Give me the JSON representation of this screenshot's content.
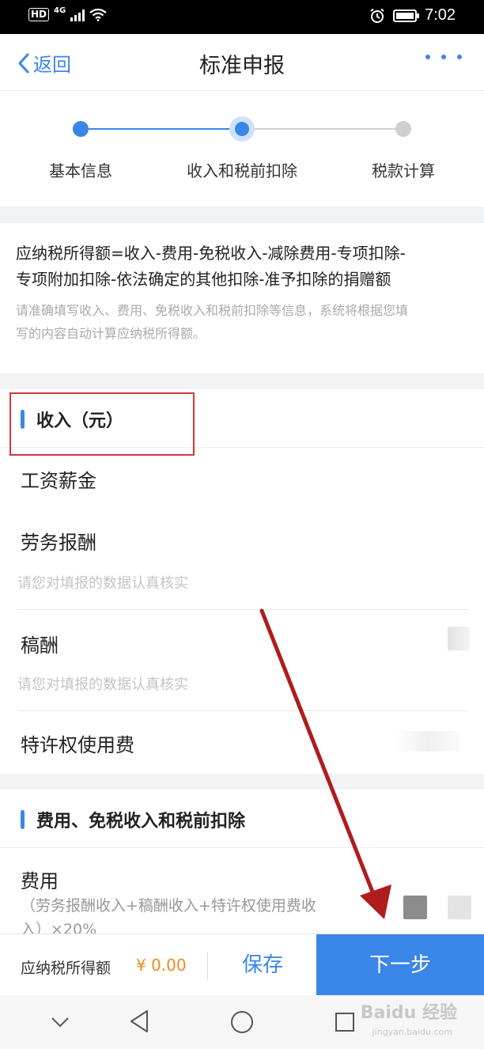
{
  "status_bar": {
    "hd": "HD",
    "network": "4G",
    "time": "7:02"
  },
  "nav": {
    "back_label": "返回",
    "title": "标准申报"
  },
  "stepper": {
    "steps": [
      {
        "label": "基本信息",
        "state": "done"
      },
      {
        "label": "收入和税前扣除",
        "state": "current"
      },
      {
        "label": "税款计算",
        "state": "pending"
      }
    ]
  },
  "formula": {
    "line1": "应纳税所得额=收入-费用-免税收入-减除费用-专项扣除-",
    "line2": "专项附加扣除-依法确定的其他扣除-准予扣除的捐赠额",
    "hint_line1": "请准确填写收入、费用、免税收入和税前扣除等信息，系统将根据您填",
    "hint_line2": "写的内容自动计算应纳税所得额。"
  },
  "income": {
    "title": "收入（元）",
    "rows": [
      {
        "label": "工资薪金"
      },
      {
        "label": "劳务报酬",
        "hint": "请您对填报的数据认真核实"
      },
      {
        "label": "稿酬",
        "hint": "请您对填报的数据认真核实"
      },
      {
        "label": "特许权使用费"
      }
    ]
  },
  "deductions": {
    "title": "费用、免税收入和税前扣除",
    "rows": [
      {
        "label": "费用",
        "note_line1": "（劳务报酬收入+稿酬收入+特许权使用费收",
        "note_line2": "入）×20%"
      }
    ]
  },
  "action_bar": {
    "tax_label": "应纳税所得额",
    "tax_value": "¥ 0.00",
    "save_label": "保存",
    "next_label": "下一步"
  },
  "watermark": {
    "text": "Baidu 经验",
    "sub": "jingyan.baidu.com"
  },
  "colors": {
    "accent": "#3a86e8",
    "amount": "#f08a1e",
    "highlight_box": "#d9343a",
    "arrow": "#b01c1c"
  }
}
